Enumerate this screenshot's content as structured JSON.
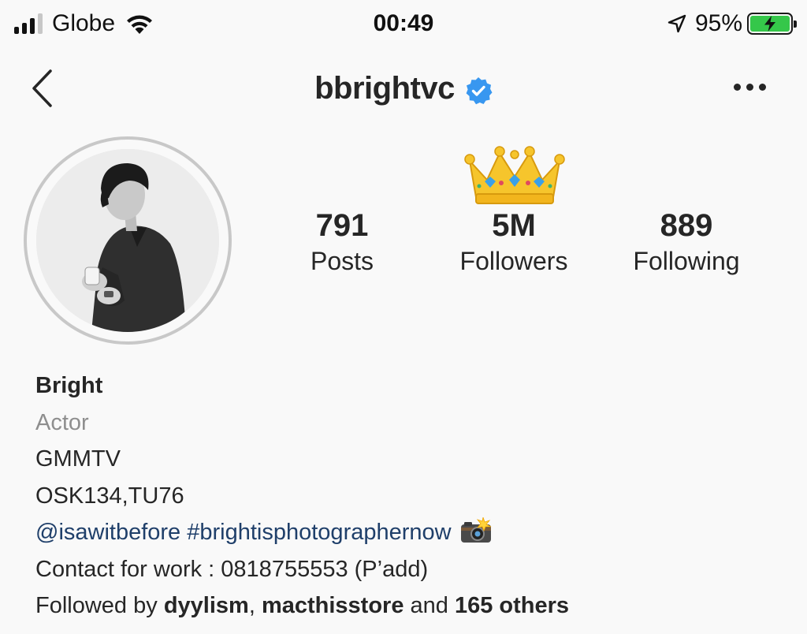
{
  "status_bar": {
    "carrier": "Globe",
    "time": "00:49",
    "battery_percent": "95%"
  },
  "header": {
    "username": "bbrightvc",
    "verified": true
  },
  "stats": {
    "posts": {
      "value": "791",
      "label": "Posts"
    },
    "followers": {
      "value": "5M",
      "label": "Followers"
    },
    "following": {
      "value": "889",
      "label": "Following"
    }
  },
  "bio": {
    "name": "Bright",
    "category": "Actor",
    "line1": "GMMTV",
    "line2": "OSK134,TU76",
    "mention": "@isawitbefore",
    "hashtag": "#brightisphotographernow",
    "contact": "Contact for work : 0818755553 (P’add)",
    "followed_by": {
      "prefix": "Followed by",
      "user1": "dyylism",
      "separator": ",",
      "user2": "macthisstore",
      "conjunction": "and",
      "others": "165 others"
    }
  },
  "icons": {
    "back": "chevron-left-icon",
    "more": "more-horizontal-icon",
    "verified": "verified-badge-icon",
    "crown": "crown-emoji",
    "camera": "camera-flash-emoji"
  },
  "colors": {
    "background": "#f9f9f9",
    "text": "#262626",
    "secondary_text": "#8e8e8e",
    "link": "#1f3f6a",
    "verified_blue": "#3897f0",
    "battery_green": "#35c74a"
  }
}
